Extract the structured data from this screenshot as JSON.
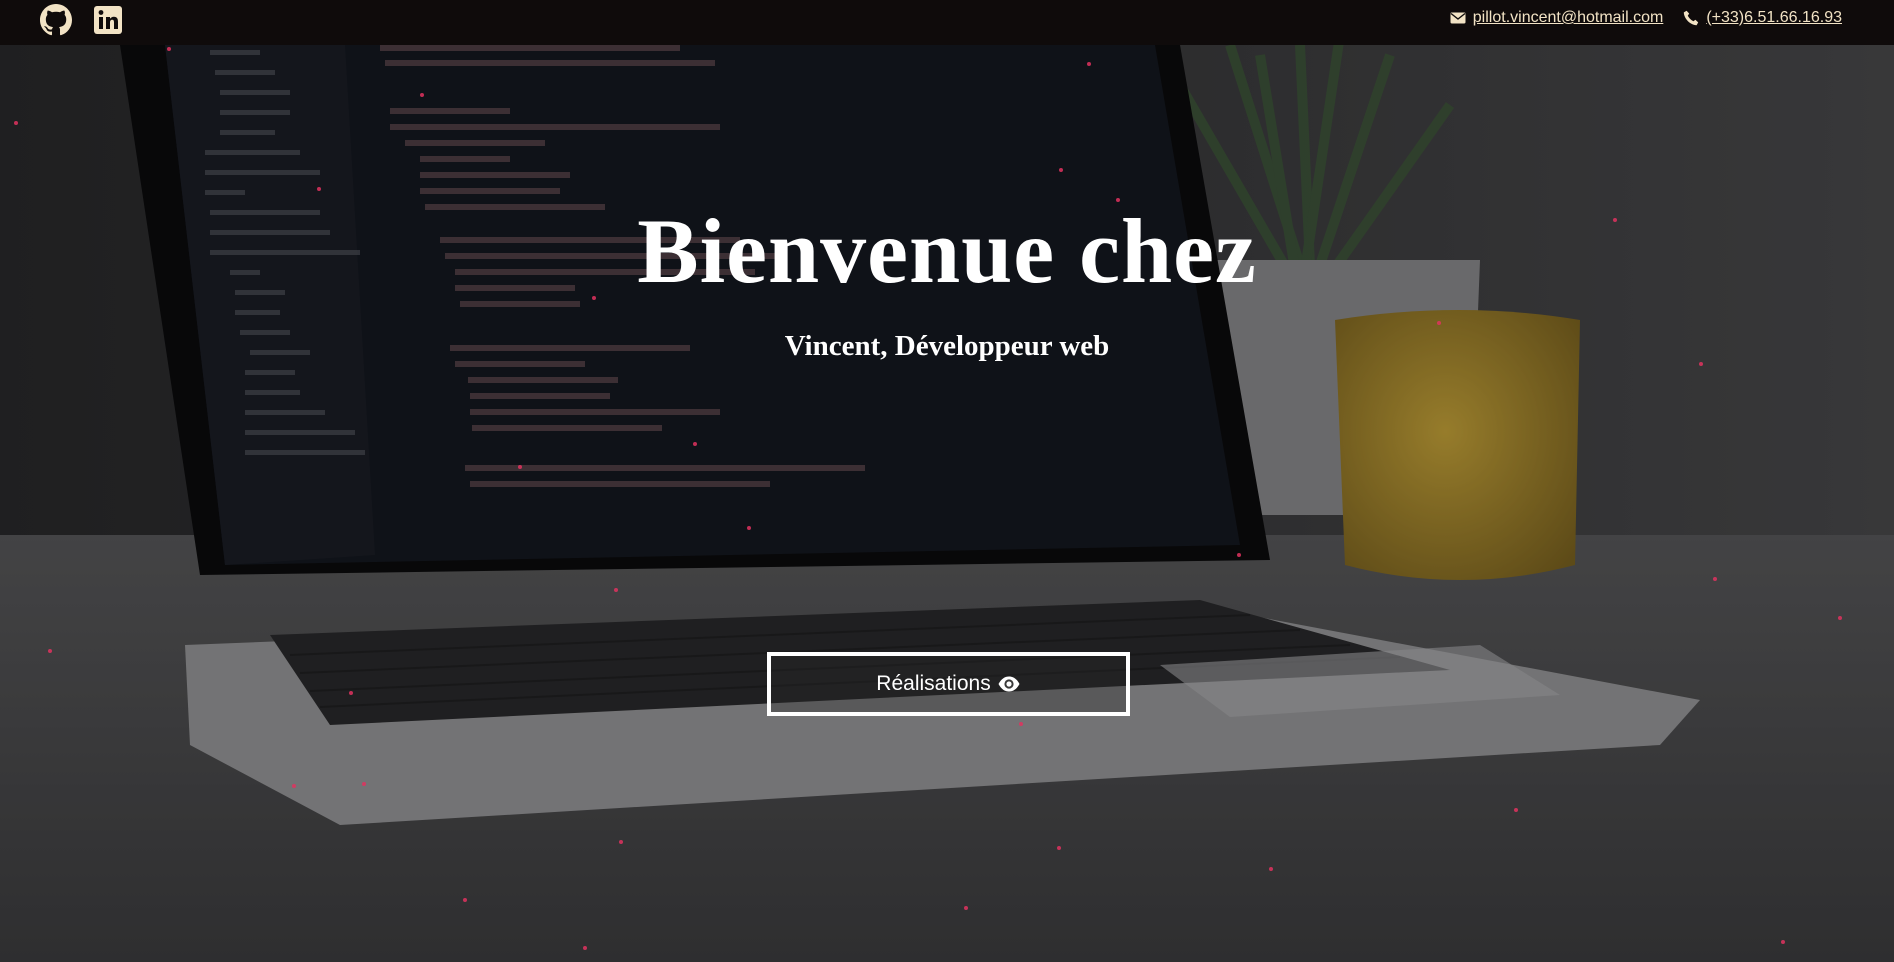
{
  "header": {
    "social": [
      {
        "name": "github",
        "icon": "github-icon"
      },
      {
        "name": "linkedin",
        "icon": "linkedin-icon"
      }
    ],
    "email": "pillot.vincent@hotmail.com",
    "phone": "(+33)6.51.66.16.93"
  },
  "hero": {
    "title": "Bienvenue chez",
    "subtitle": "Vincent, Développeur web",
    "cta_label": "Réalisations",
    "cta_icon": "eye-icon"
  },
  "colors": {
    "topbar": "#0f0b0b",
    "link": "#f2e3c5",
    "particles": "#e0325f",
    "text": "#ffffff"
  }
}
